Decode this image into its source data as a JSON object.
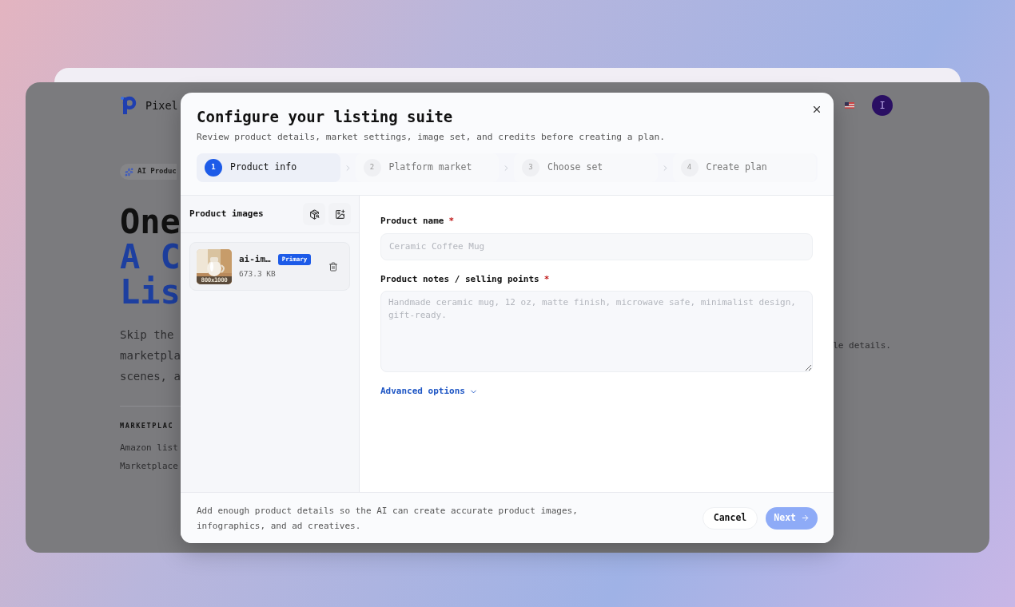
{
  "backdrop": {
    "logo_text": "Pixel",
    "badge": "AI Produc",
    "headline": [
      {
        "text": "One",
        "kind": "dark"
      },
      {
        "text": "A C",
        "kind": "accent"
      },
      {
        "text": "Lis",
        "kind": "accent"
      }
    ],
    "paragraph_lines": [
      "Skip the",
      "marketpla",
      "scenes, a"
    ],
    "paragraph_tail": "le details.",
    "section_label": "MARKETPLAC",
    "section_lines": [
      "Amazon list",
      "Marketplace"
    ],
    "avatar": "I"
  },
  "dialog": {
    "title": "Configure your listing suite",
    "subtitle": "Review product details, market settings, image set, and credits before creating a plan.",
    "steps": [
      {
        "number": "1",
        "label": "Product info",
        "selected": true
      },
      {
        "number": "2",
        "label": "Platform market",
        "selected": false
      },
      {
        "number": "3",
        "label": "Choose set",
        "selected": false
      },
      {
        "number": "4",
        "label": "Create plan",
        "selected": false
      }
    ],
    "images_panel": {
      "title": "Product images",
      "images": [
        {
          "name": "ai-im…",
          "badge": "Primary",
          "size": "673.3 KB",
          "dimensions": "800x1000"
        }
      ]
    },
    "fields": [
      {
        "kind": "input",
        "label": "Product name",
        "required_mark": "*",
        "placeholder": "Ceramic Coffee Mug"
      },
      {
        "kind": "textarea",
        "label": "Product notes / selling points",
        "required_mark": "*",
        "placeholder": "Handmade ceramic mug, 12 oz, matte finish, microwave safe, minimalist design, gift-ready."
      }
    ],
    "advanced": {
      "label": "Advanced options",
      "expanded": false
    },
    "footer_note": "Add enough product details so the AI can create accurate product images, infographics, and ad creatives.",
    "cancel": "Cancel",
    "next": {
      "label": "Next",
      "disabled": true
    }
  }
}
